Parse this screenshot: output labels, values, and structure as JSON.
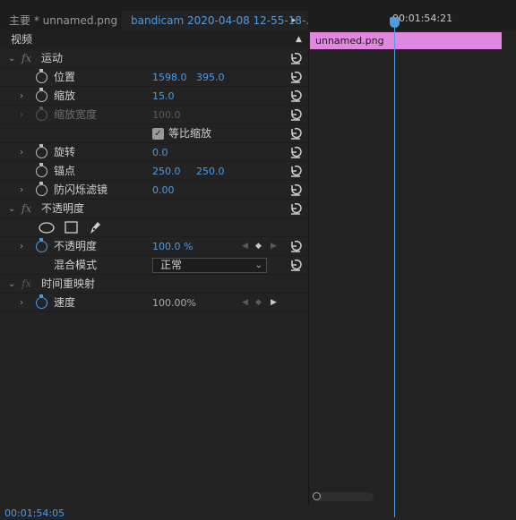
{
  "tabs": {
    "source": "主要 * unnamed.png",
    "sequence": "bandicam 2020-04-08 12-55-18-...",
    "arrow": "▸"
  },
  "section": {
    "video_label": "视频",
    "collapse_glyph": "▲"
  },
  "motion": {
    "title": "运动",
    "fx": "fx",
    "position": {
      "label": "位置",
      "x": "1598.0",
      "y": "395.0"
    },
    "scale": {
      "label": "缩放",
      "value": "15.0"
    },
    "scale_width": {
      "label": "缩放宽度",
      "value": "100.0"
    },
    "uniform_scale": {
      "label": "等比缩放",
      "checked": true
    },
    "rotation": {
      "label": "旋转",
      "value": "0.0"
    },
    "anchor": {
      "label": "锚点",
      "x": "250.0",
      "y": "250.0"
    },
    "anti_flicker": {
      "label": "防闪烁滤镜",
      "value": "0.00"
    }
  },
  "opacity": {
    "title": "不透明度",
    "fx": "fx",
    "opacity": {
      "label": "不透明度",
      "value": "100.0 %"
    },
    "blend_mode": {
      "label": "混合模式",
      "value": "正常"
    }
  },
  "time_remap": {
    "title": "时间重映射",
    "fx": "fx",
    "speed": {
      "label": "速度",
      "value": "100.00%"
    }
  },
  "timeline": {
    "ruler_time": "00:01:54:21",
    "clip_name": "unnamed.png",
    "clip_color": "#e087e0"
  },
  "footer": {
    "timecode": "00:01:54:05"
  },
  "colors": {
    "accent": "#4e9be3",
    "panel": "#232323"
  }
}
